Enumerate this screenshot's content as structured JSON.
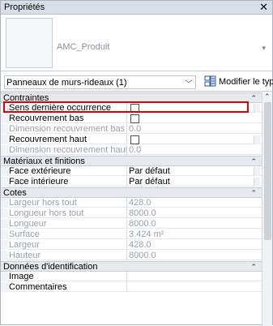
{
  "window": {
    "title": "Propriétés",
    "close": "✕"
  },
  "preview": {
    "type_name": "AMC_Produit",
    "chevron": "▾"
  },
  "selector": {
    "value": "Panneaux de murs-rideaux (1)",
    "chevron": "﹀",
    "modify_type_label": "Modifier le type"
  },
  "groups": [
    {
      "label": "Contraintes",
      "chevron": "⌃"
    },
    {
      "label": "Matériaux et finitions",
      "chevron": "⌃"
    },
    {
      "label": "Cotes",
      "chevron": "⌃"
    },
    {
      "label": "Données d'identification",
      "chevron": "⌃"
    }
  ],
  "contraintes": [
    {
      "name": "Sens dernière occurrence",
      "value": "",
      "checkbox": true,
      "dim": false
    },
    {
      "name": "Recouvrement bas",
      "value": "",
      "checkbox": true,
      "dim": false
    },
    {
      "name": "Dimension recouvrement bas",
      "value": "0.0",
      "checkbox": false,
      "dim": true
    },
    {
      "name": "Recouvrement haut",
      "value": "",
      "checkbox": true,
      "dim": false
    },
    {
      "name": "Dimension recouvrement haut",
      "value": "0.0",
      "checkbox": false,
      "dim": true
    }
  ],
  "materiaux": [
    {
      "name": "Face extérieure",
      "value": "Par défaut"
    },
    {
      "name": "Face intérieure",
      "value": "Par défaut"
    }
  ],
  "cotes": [
    {
      "name": "Largeur hors tout",
      "value": "428.0"
    },
    {
      "name": "Longueur hors tout",
      "value": "8000.0"
    },
    {
      "name": "Longueur",
      "value": "8000.0"
    },
    {
      "name": "Surface",
      "value": "3.424 m²"
    },
    {
      "name": "Largeur",
      "value": "428.0"
    },
    {
      "name": "Hauteur",
      "value": "8000.0"
    }
  ],
  "identification": [
    {
      "name": "Image",
      "value": ""
    },
    {
      "name": "Commentaires",
      "value": ""
    }
  ],
  "scrollbar": {
    "up": "⌃"
  }
}
